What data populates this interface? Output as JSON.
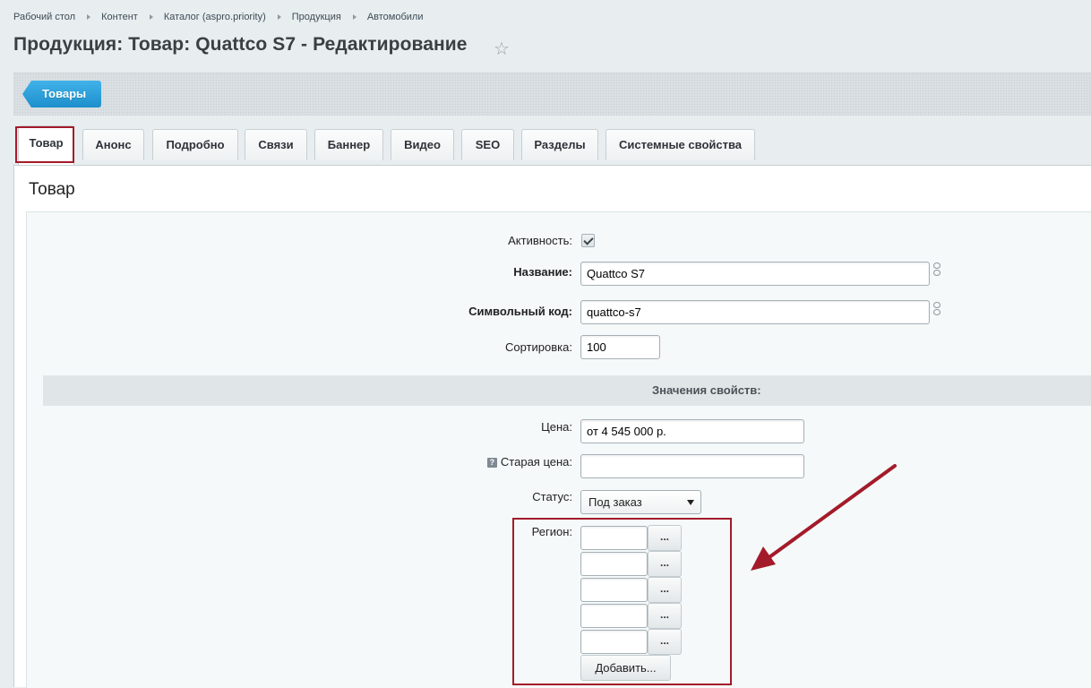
{
  "breadcrumb": [
    "Рабочий стол",
    "Контент",
    "Каталог (aspro.priority)",
    "Продукция",
    "Автомобили"
  ],
  "page": {
    "title": "Продукция: Товар: Quattco S7 - Редактирование",
    "favorite_icon": "star-outline-icon"
  },
  "toolbar": {
    "items_button": "Товары"
  },
  "tabs": [
    "Товар",
    "Анонс",
    "Подробно",
    "Связи",
    "Баннер",
    "Видео",
    "SEO",
    "Разделы",
    "Системные свойства"
  ],
  "panel": {
    "title": "Товар"
  },
  "form": {
    "active_label": "Активность:",
    "active_checked": true,
    "name_label": "Название:",
    "name_value": "Quattco S7",
    "code_label": "Символьный код:",
    "code_value": "quattco-s7",
    "sort_label": "Сортировка:",
    "sort_value": "100",
    "link_icon": "link-chain-icon"
  },
  "properties": {
    "header": "Значения свойств:",
    "price_label": "Цена:",
    "price_value": "от 4 545 000 р.",
    "old_price_label": "Старая цена:",
    "old_price_value": "",
    "help_icon": "?",
    "status_label": "Статус:",
    "status_value": "Под заказ",
    "region_label": "Регион:",
    "region_button": "...",
    "add_button": "Добавить..."
  },
  "colors": {
    "annotation": "#a31b2a",
    "accent": "#1d8fcc"
  }
}
